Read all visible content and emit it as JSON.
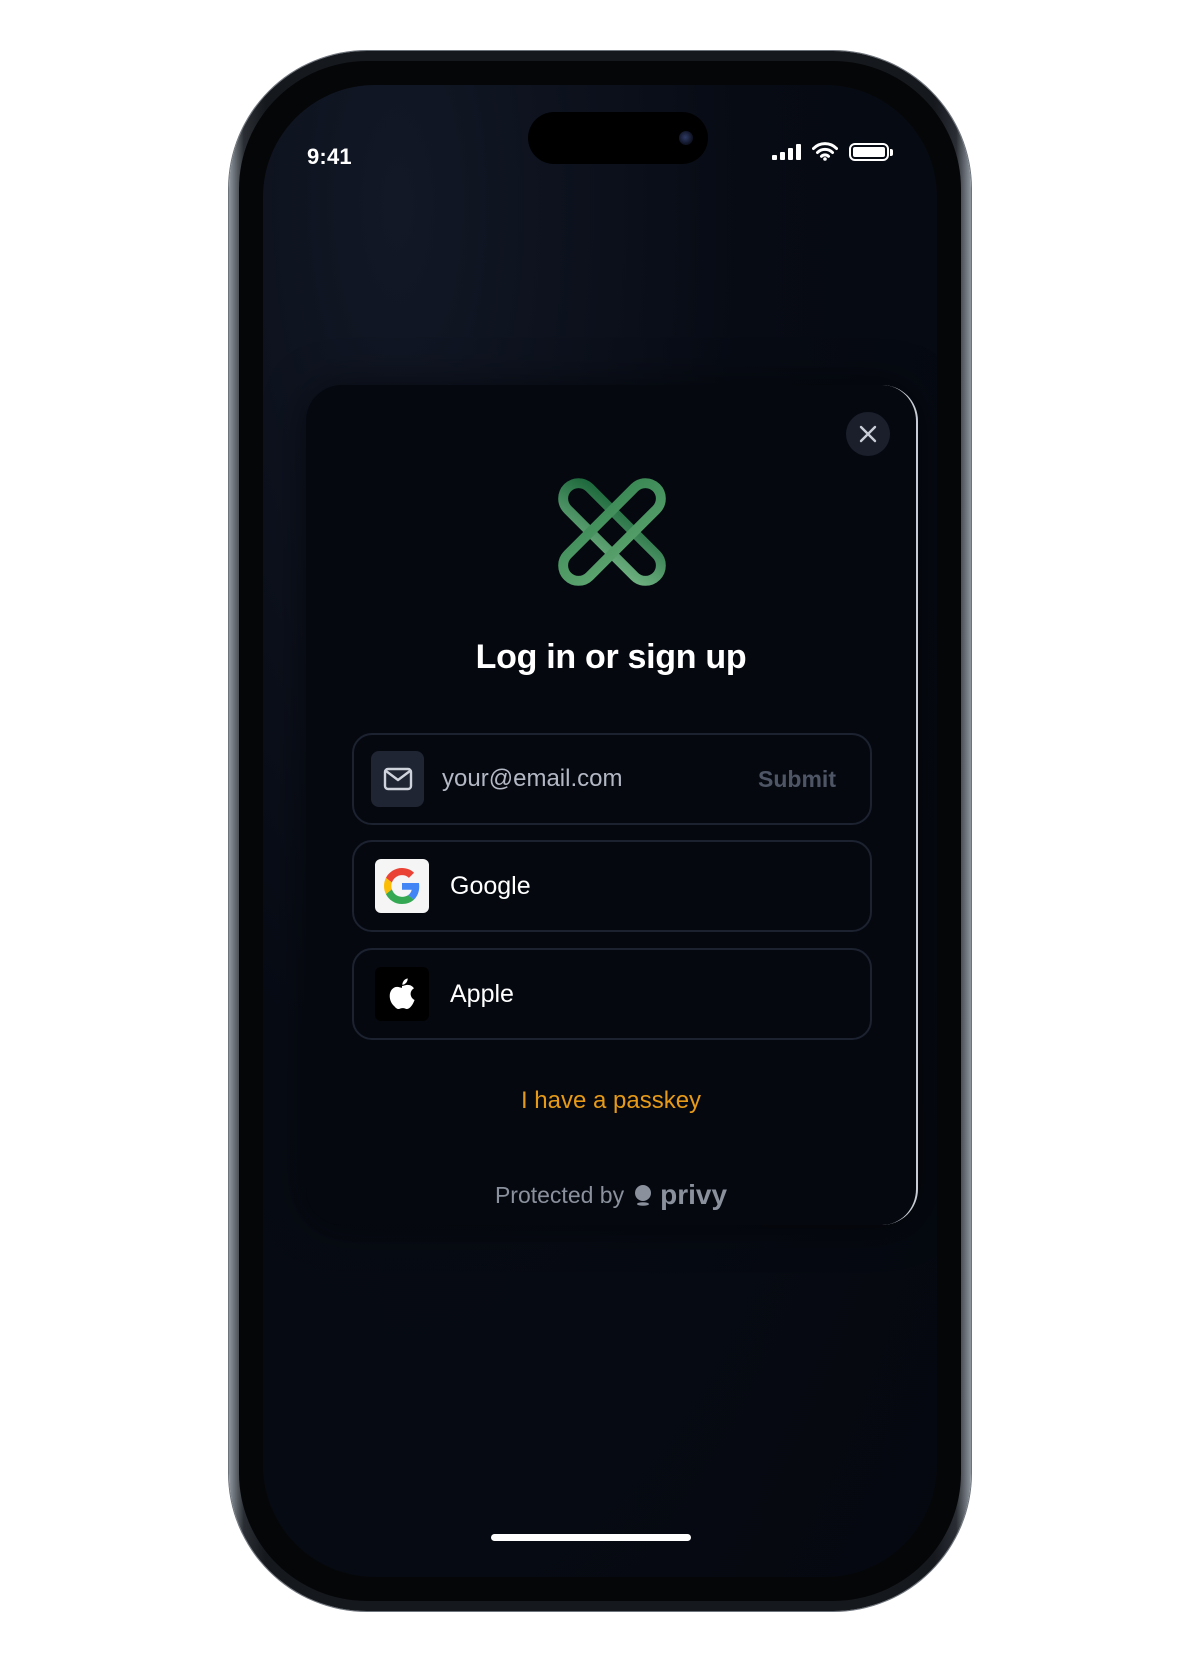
{
  "status_bar": {
    "time": "9:41",
    "signal_icon": "cellular-signal-icon",
    "wifi_icon": "wifi-icon",
    "battery_icon": "battery-icon"
  },
  "modal": {
    "title": "Log in or sign up",
    "close_icon": "close-icon",
    "logo_icon": "green-link-x-logo"
  },
  "email": {
    "placeholder": "your@email.com",
    "submit_label": "Submit",
    "icon": "mail-icon"
  },
  "providers": [
    {
      "label": "Google",
      "icon": "google-logo-icon"
    },
    {
      "label": "Apple",
      "icon": "apple-logo-icon"
    }
  ],
  "passkey_label": "I have a passkey",
  "footer": {
    "protected_by": "Protected by",
    "brand": "privy"
  },
  "colors": {
    "background": "#05080f",
    "accent": "#e69a17",
    "logo_green": "#4a9a6a",
    "border": "#1c2230"
  }
}
